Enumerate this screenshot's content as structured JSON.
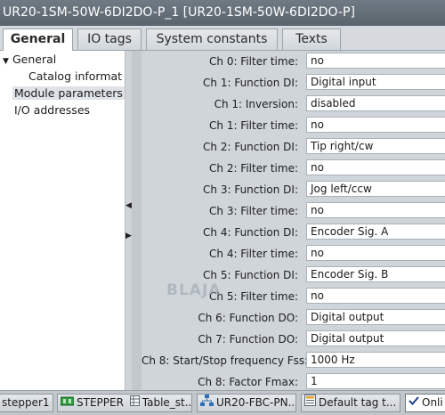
{
  "window": {
    "title": "UR20-1SM-50W-6DI2DO-P_1 [UR20-1SM-50W-6DI2DO-P]"
  },
  "tabs": [
    {
      "label": "General",
      "active": true
    },
    {
      "label": "IO tags",
      "active": false
    },
    {
      "label": "System constants",
      "active": false
    },
    {
      "label": "Texts",
      "active": false
    }
  ],
  "nav": {
    "general": "General",
    "catalog": "Catalog information",
    "module_parameters": "Module parameters",
    "io_addresses": "I/O addresses"
  },
  "params": [
    {
      "label": "Ch 0: Filter time:",
      "value": "no"
    },
    {
      "label": "Ch 1: Function DI:",
      "value": "Digital input"
    },
    {
      "label": "Ch 1: Inversion:",
      "value": "disabled"
    },
    {
      "label": "Ch 1: Filter time:",
      "value": "no"
    },
    {
      "label": "Ch 2: Function DI:",
      "value": "Tip right/cw"
    },
    {
      "label": "Ch 2: Filter time:",
      "value": "no"
    },
    {
      "label": "Ch 3: Function DI:",
      "value": "Jog left/ccw"
    },
    {
      "label": "Ch 3: Filter time:",
      "value": "no"
    },
    {
      "label": "Ch 4: Function DI:",
      "value": "Encoder Sig. A"
    },
    {
      "label": "Ch 4: Filter time:",
      "value": "no"
    },
    {
      "label": "Ch 5: Function DI:",
      "value": "Encoder Sig. B"
    },
    {
      "label": "Ch 5: Filter time:",
      "value": "no"
    },
    {
      "label": "Ch 6: Function DO:",
      "value": "Digital output"
    },
    {
      "label": "Ch 7: Function DO:",
      "value": "Digital output"
    },
    {
      "label": "Ch 8: Start/Stop frequency Fss:",
      "value": "1000 Hz"
    },
    {
      "label": "Ch 8: Factor Fmax:",
      "value": "1"
    }
  ],
  "watermark": "BLAJA",
  "taskbar": [
    {
      "label": "stepper1",
      "icon": "none"
    },
    {
      "label": "STEPPER",
      "icon": "plc-module-icon"
    },
    {
      "label": "Table_st...",
      "icon": "table-icon"
    },
    {
      "label": "UR20-FBC-PN...",
      "icon": "network-icon"
    },
    {
      "label": "Default tag t...",
      "icon": "tag-table-icon"
    },
    {
      "label": "Onli",
      "icon": "check-icon"
    }
  ]
}
